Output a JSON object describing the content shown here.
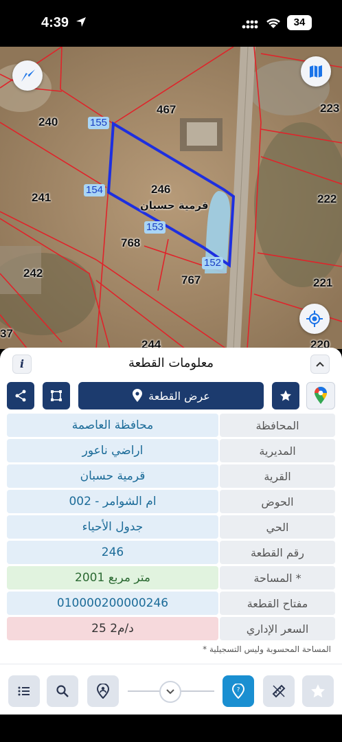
{
  "status": {
    "time": "4:39",
    "battery": "34"
  },
  "map": {
    "parcels": [
      "240",
      "467",
      "223",
      "241",
      "246",
      "222",
      "768",
      "242",
      "767",
      "221",
      "37",
      "244",
      "220"
    ],
    "vertices": [
      "155",
      "154",
      "153",
      "152"
    ],
    "village_label": "قرمية حسبان"
  },
  "sheet": {
    "title": "معلومات القطعة",
    "info_label": "i",
    "view_button": "عرض القطعة",
    "rows": [
      {
        "key": "المحافظة",
        "value": "محافظة العاصمة"
      },
      {
        "key": "المديرية",
        "value": "اراضي ناعور"
      },
      {
        "key": "القرية",
        "value": "قرمية حسبان"
      },
      {
        "key": "الحوض",
        "value": "ام الشوامر - 002"
      },
      {
        "key": "الحي",
        "value": "جدول الأحياء"
      },
      {
        "key": "رقم القطعة",
        "value": "246"
      },
      {
        "key": "المساحة *",
        "value": "2001  متر مربع"
      },
      {
        "key": "مفتاح القطعة",
        "value": "010000200000246"
      },
      {
        "key": "السعر الإداري",
        "value": "25 د/م2"
      }
    ],
    "footnote": "* المساحة المحسوبة وليس التسجيلية"
  },
  "colors": {
    "primary": "#1c3b6e",
    "accent": "#1a8fd1",
    "parcel_outline": "#1d2fe0",
    "boundary": "#e0232a"
  },
  "icons": [
    "location-arrow-icon",
    "signal-icon",
    "wifi-icon",
    "compass-icon",
    "map-layers-icon",
    "locate-icon",
    "share-icon",
    "crop-icon",
    "pin-icon",
    "star-icon",
    "google-maps-icon",
    "list-icon",
    "search-icon",
    "pin-user-icon",
    "chevron-down-icon",
    "help-pin-icon",
    "ruler-icon",
    "favorites-icon"
  ]
}
